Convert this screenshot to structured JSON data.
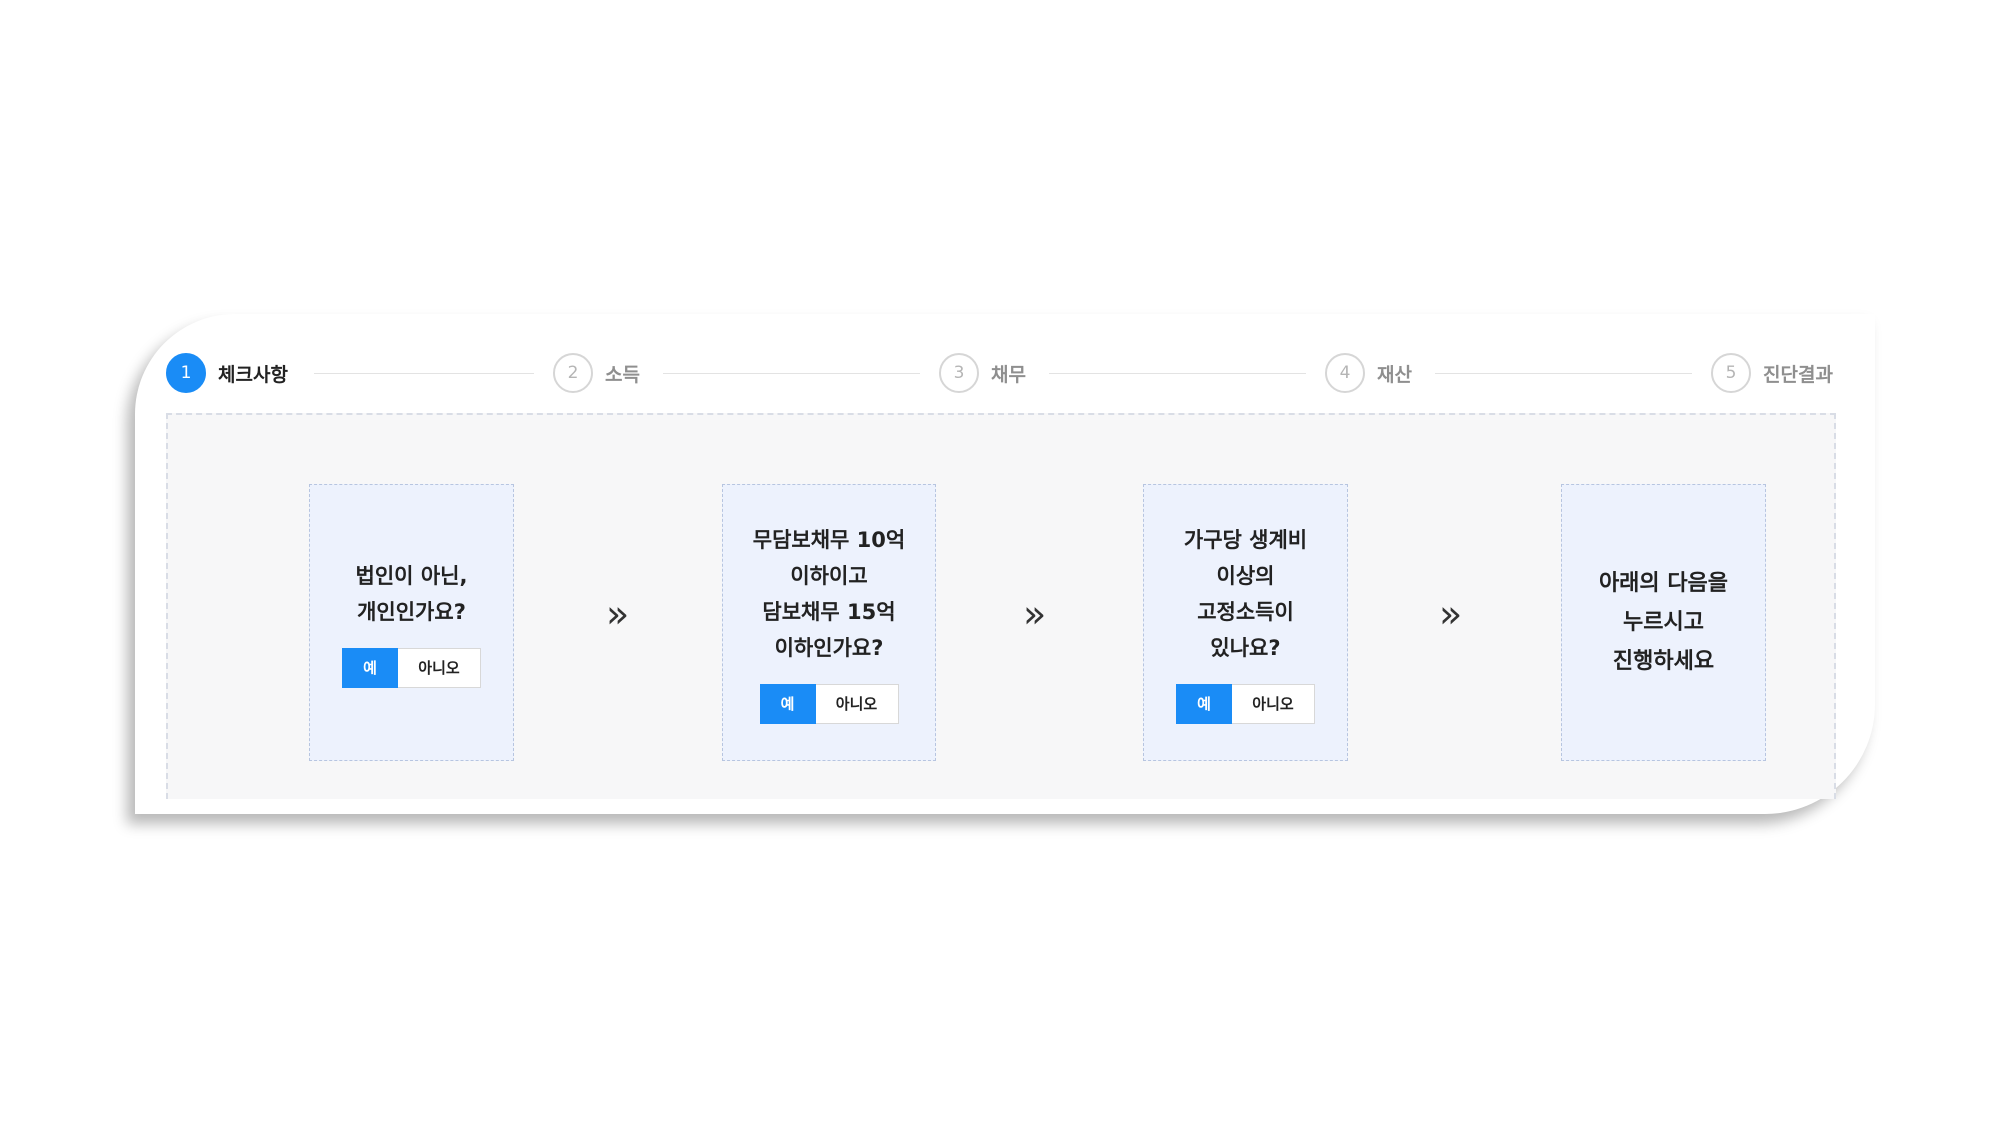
{
  "steps": [
    {
      "num": "1",
      "label": "체크사항",
      "active": true
    },
    {
      "num": "2",
      "label": "소득",
      "active": false
    },
    {
      "num": "3",
      "label": "채무",
      "active": false
    },
    {
      "num": "4",
      "label": "재산",
      "active": false
    },
    {
      "num": "5",
      "label": "진단결과",
      "active": false
    }
  ],
  "questions": [
    {
      "text": "법인이 아닌,\n개인인가요?",
      "yes": "예",
      "no": "아니오"
    },
    {
      "text": "무담보채무 10억\n이하이고\n담보채무 15억\n이하인가요?",
      "yes": "예",
      "no": "아니오"
    },
    {
      "text": "가구당 생계비\n이상의\n고정소득이\n있나요?",
      "yes": "예",
      "no": "아니오"
    }
  ],
  "final": {
    "text": "아래의 다음을\n누르시고\n진행하세요"
  },
  "arrow_glyph": "»",
  "colors": {
    "accent": "#1a8cf6",
    "box_bg": "#edf2fd",
    "panel_bg": "#f7f7f8"
  }
}
